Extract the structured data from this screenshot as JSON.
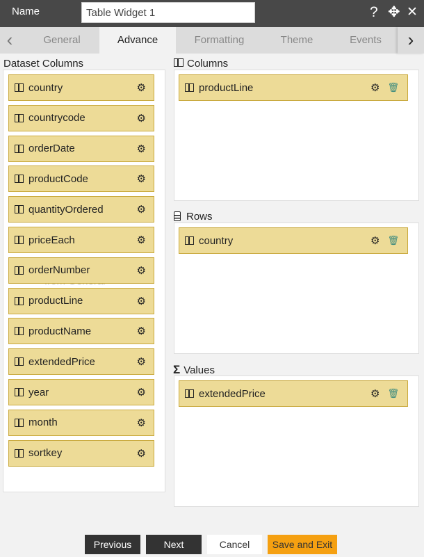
{
  "header": {
    "name_label": "Name",
    "name_value": "Table Widget 1",
    "help_icon": "?",
    "move_icon": "✥",
    "close_icon": "✕"
  },
  "tabs": [
    {
      "label": "General"
    },
    {
      "label": "Advance",
      "active": true
    },
    {
      "label": "Formatting"
    },
    {
      "label": "Theme"
    },
    {
      "label": "Events"
    }
  ],
  "dataset": {
    "title": "Dataset Columns",
    "ghost_text": "from General",
    "items": [
      "country",
      "countrycode",
      "orderDate",
      "productCode",
      "quantityOrdered",
      "priceEach",
      "orderNumber",
      "productLine",
      "productName",
      "extendedPrice",
      "year",
      "month",
      "sortkey"
    ]
  },
  "columns": {
    "title": "Columns",
    "items": [
      "productLine"
    ]
  },
  "rows": {
    "title": "Rows",
    "items": [
      "country"
    ]
  },
  "values": {
    "title": "Values",
    "icon": "Σ",
    "items": [
      "extendedPrice"
    ]
  },
  "footer": {
    "previous": "Previous",
    "next": "Next",
    "cancel": "Cancel",
    "save": "Save and Exit"
  },
  "colors": {
    "header": "#484848",
    "item_bg": "#eddb97",
    "item_border": "#c9a93c",
    "save": "#f5a011",
    "dark_button": "#333333"
  }
}
